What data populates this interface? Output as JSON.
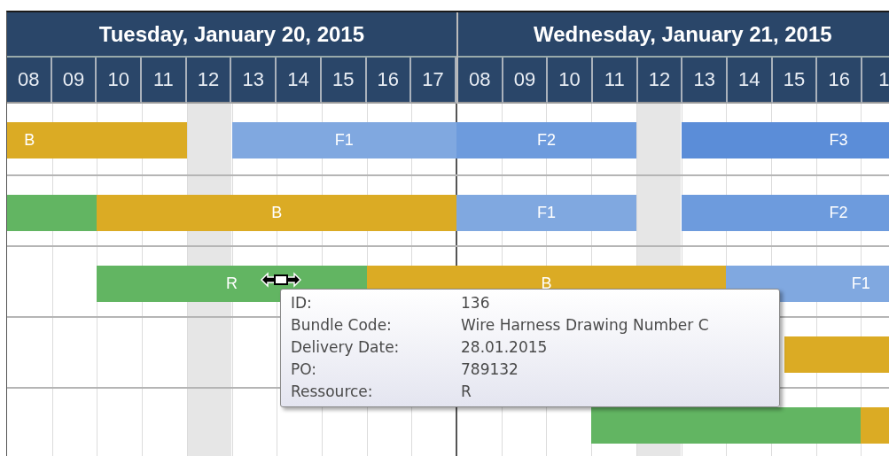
{
  "days": [
    {
      "title": "Tuesday, January 20, 2015",
      "hours": [
        {
          "label": "08",
          "break": false
        },
        {
          "label": "09",
          "break": false
        },
        {
          "label": "10",
          "break": false
        },
        {
          "label": "11",
          "break": false
        },
        {
          "label": "12",
          "break": true
        },
        {
          "label": "13",
          "break": false
        },
        {
          "label": "14",
          "break": false
        },
        {
          "label": "15",
          "break": false
        },
        {
          "label": "16",
          "break": false
        },
        {
          "label": "17",
          "break": false
        }
      ]
    },
    {
      "title": "Wednesday, January 21, 2015",
      "hours": [
        {
          "label": "08",
          "break": false
        },
        {
          "label": "09",
          "break": false
        },
        {
          "label": "10",
          "break": false
        },
        {
          "label": "11",
          "break": false
        },
        {
          "label": "12",
          "break": true
        },
        {
          "label": "13",
          "break": false
        },
        {
          "label": "14",
          "break": false
        },
        {
          "label": "15",
          "break": false
        },
        {
          "label": "16",
          "break": false
        },
        {
          "label": "1",
          "break": false
        }
      ]
    }
  ],
  "rows": [
    {
      "bars": [
        {
          "label": "B",
          "color": "#dbab24"
        },
        {
          "label": "F1",
          "color": "#80a8e0"
        },
        {
          "label": "F2",
          "color": "#6d9bdd"
        },
        {
          "label": "F3",
          "color": "#5b8dd8"
        }
      ]
    },
    {
      "bars": [
        {
          "color": "#62b562"
        },
        {
          "label": "B",
          "color": "#dbab24"
        },
        {
          "label": "F1",
          "color": "#80a8e0"
        },
        {
          "label": "F2",
          "color": "#6d9bdd"
        }
      ]
    },
    {
      "bars": [
        {
          "label": "R",
          "color": "#62b562"
        },
        {
          "label": "B",
          "color": "#dbab24"
        },
        {
          "label": "F1",
          "color": "#80a8e0"
        }
      ]
    },
    {
      "bars": [
        {
          "color": "#dbab24"
        }
      ]
    },
    {
      "bars": [
        {
          "color": "#62b562"
        },
        {
          "color": "#dbab24"
        }
      ]
    }
  ],
  "tooltip": {
    "rows": [
      {
        "label": "ID:",
        "value": "136"
      },
      {
        "label": "Bundle Code:",
        "value": "Wire Harness Drawing Number C"
      },
      {
        "label": "Delivery Date:",
        "value": "28.01.2015"
      },
      {
        "label": "PO:",
        "value": "789132"
      },
      {
        "label": "Ressource:",
        "value": "R"
      }
    ]
  }
}
